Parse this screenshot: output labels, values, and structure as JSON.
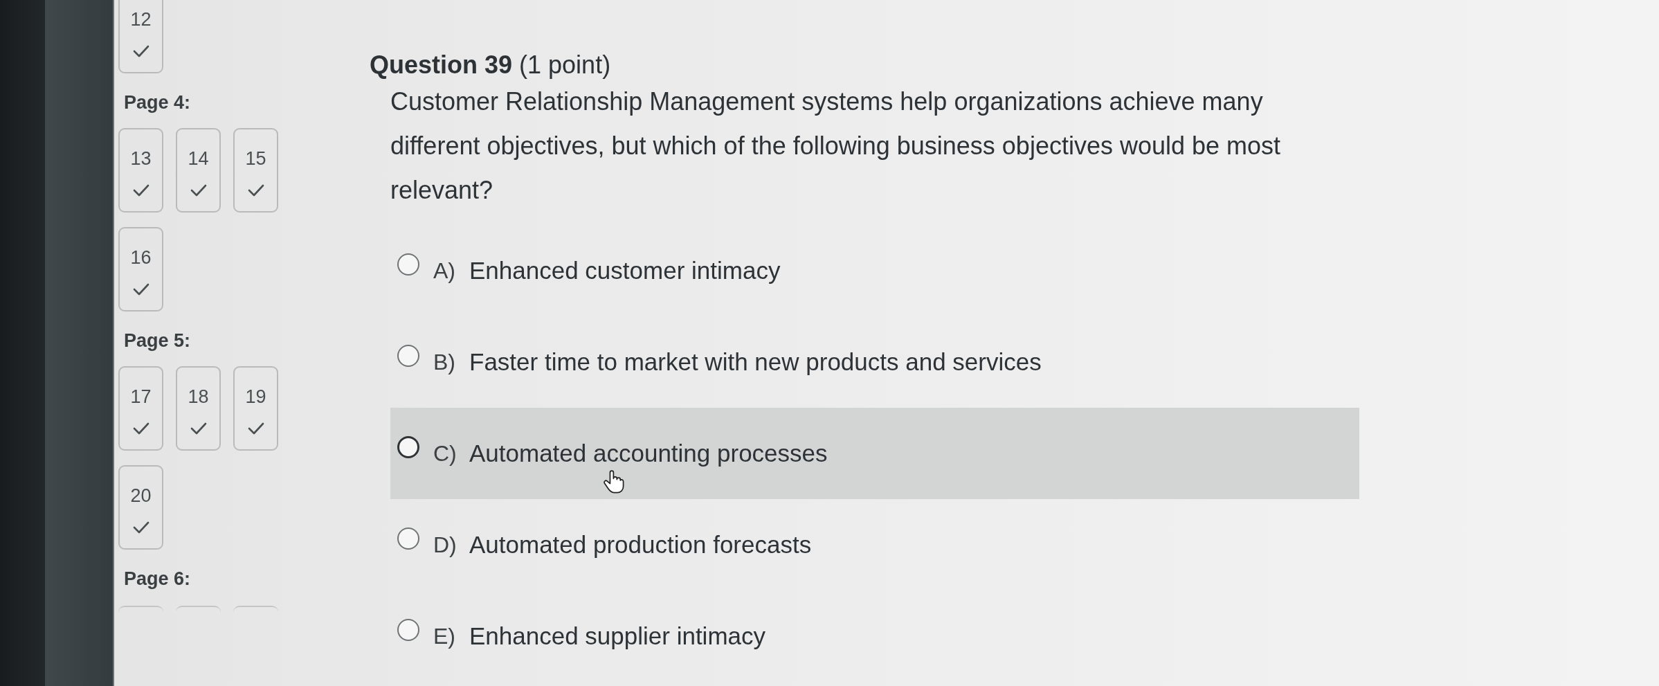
{
  "sidebar": {
    "pages": [
      {
        "questions": [
          {
            "number": "12",
            "answered": true
          }
        ]
      },
      {
        "label": "Page 4:",
        "questions": [
          {
            "number": "13",
            "answered": true
          },
          {
            "number": "14",
            "answered": true
          },
          {
            "number": "15",
            "answered": true
          },
          {
            "number": "16",
            "answered": true
          }
        ]
      },
      {
        "label": "Page 5:",
        "questions": [
          {
            "number": "17",
            "answered": true
          },
          {
            "number": "18",
            "answered": true
          },
          {
            "number": "19",
            "answered": true
          },
          {
            "number": "20",
            "answered": true
          }
        ]
      },
      {
        "label": "Page 6:",
        "tiles_cut_off": true
      }
    ]
  },
  "question": {
    "title": "**Question 39** (1 point)",
    "text": "Customer Relationship Management systems help organizations achieve many different objectives, but which of the following business objectives would be most relevant?",
    "options": [
      {
        "letter": "A)",
        "text": "Enhanced customer intimacy",
        "selected": false,
        "hovered": false
      },
      {
        "letter": "B)",
        "text": "Faster time to market with new products and services",
        "selected": false,
        "hovered": false
      },
      {
        "letter": "C)",
        "text": "Automated accounting processes",
        "selected": false,
        "hovered": true
      },
      {
        "letter": "D)",
        "text": "Automated production forecasts",
        "selected": false,
        "hovered": false
      },
      {
        "letter": "E)",
        "text": "Enhanced supplier intimacy",
        "selected": false,
        "hovered": false
      }
    ]
  }
}
